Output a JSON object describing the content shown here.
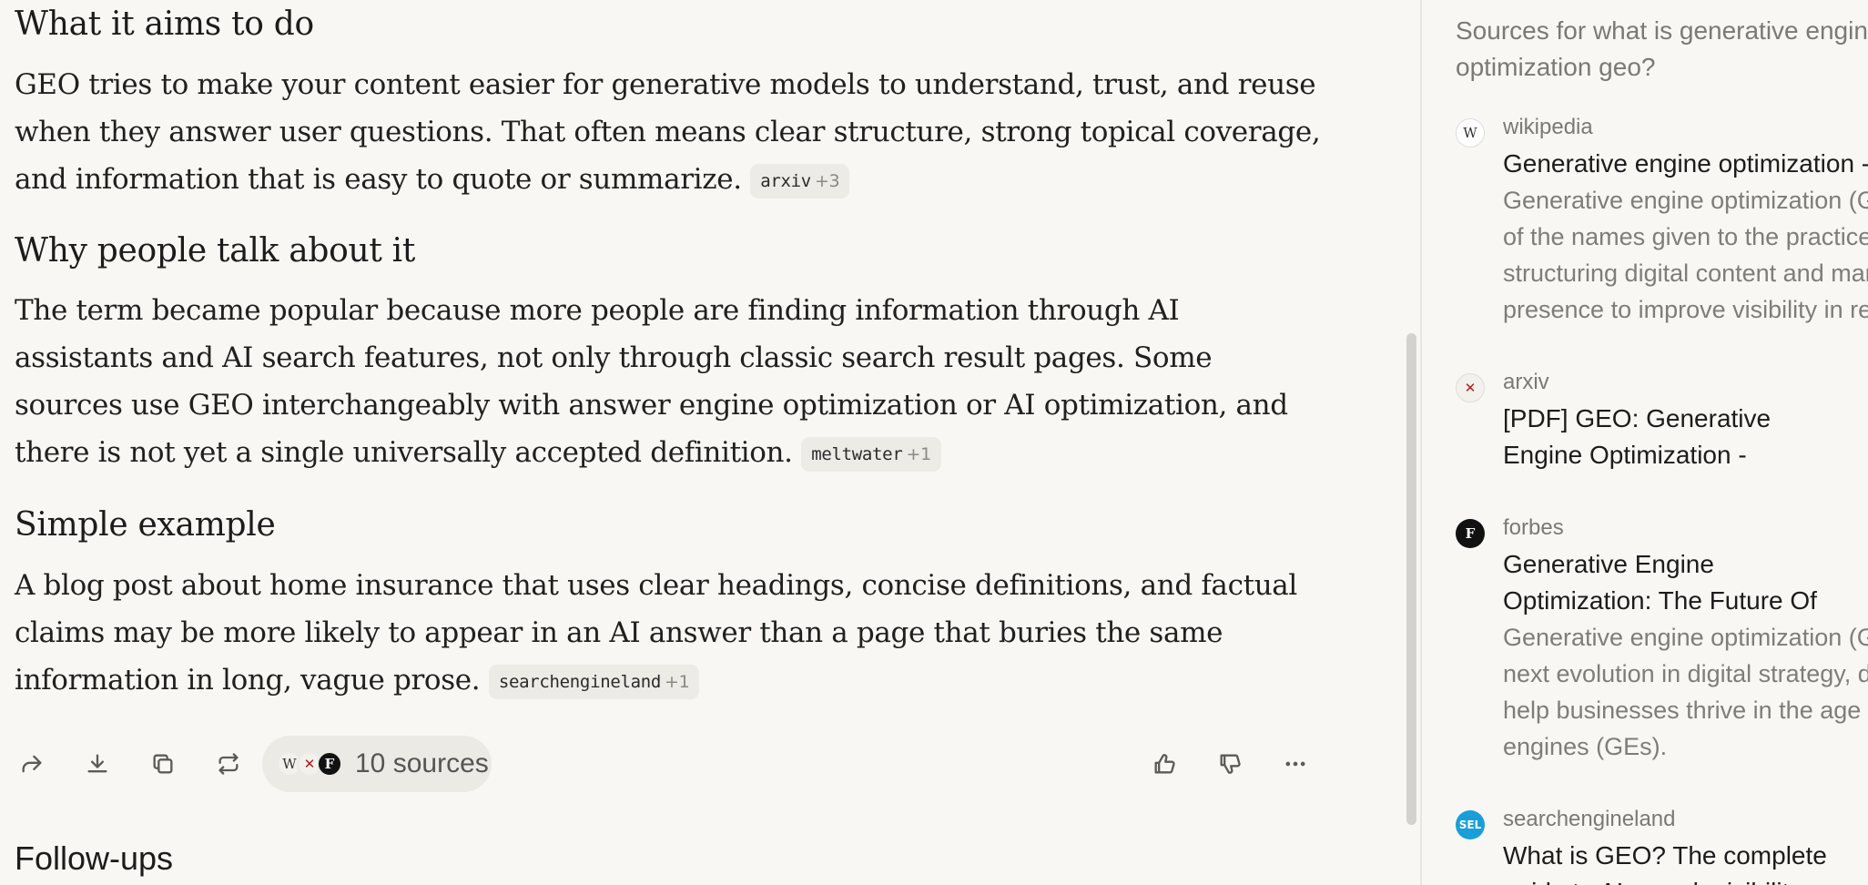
{
  "answer": {
    "sections": [
      {
        "heading": "What it aims to do",
        "text": "GEO tries to make your content easier for generative models to understand, trust, and reuse when they answer user questions. That often means clear structure, strong topical coverage, and information that is easy to quote or summarize.",
        "citation": {
          "source": "arxiv",
          "more": "+3"
        }
      },
      {
        "heading": "Why people talk about it",
        "text": "The term became popular because more people are finding information through AI assistants and AI search features, not only through classic search result pages. Some sources use GEO interchangeably with answer engine optimization or AI optimization, and there is not yet a single universally accepted definition.",
        "citation": {
          "source": "meltwater",
          "more": "+1"
        }
      },
      {
        "heading": "Simple example",
        "text": "A blog post about home insurance that uses clear headings, concise definitions, and factual claims may be more likely to appear in an AI answer than a page that buries the same information in long, vague prose.",
        "citation": {
          "source": "searchengineland",
          "more": "+1"
        }
      }
    ]
  },
  "actions": {
    "sources_label": "10 sources",
    "icons": [
      "share-icon",
      "download-icon",
      "copy-icon",
      "rewrite-icon",
      "thumbs-up-icon",
      "thumbs-down-icon",
      "more-icon"
    ]
  },
  "followups": {
    "heading": "Follow-ups"
  },
  "sidebar": {
    "title": "Sources for what is generative engine optimization geo?",
    "sources": [
      {
        "domain": "wikipedia",
        "title": "Generative engine optimization - Wikipedia",
        "snippet": "Generative engine optimization (GEO) is one of the names given to the practice of structuring digital content and managing online presence to improve visibility in responses generated by AI."
      },
      {
        "domain": "arxiv",
        "title": "[PDF] GEO: Generative Engine Optimization - arXiv",
        "snippet": ""
      },
      {
        "domain": "forbes",
        "title": "Generative Engine Optimization: The Future Of Search Is Here",
        "snippet": "Generative engine optimization (GEO) is the next evolution in digital strategy, designed to help businesses thrive in the age of generative engines (GEs)."
      },
      {
        "domain": "searchengineland",
        "title": "What is GEO? The complete guide to AI search visibility",
        "snippet": ""
      }
    ]
  },
  "colors": {
    "background": "#f8f7f3",
    "pill": "#ebeae5",
    "muted_text": "#7a7a75"
  }
}
